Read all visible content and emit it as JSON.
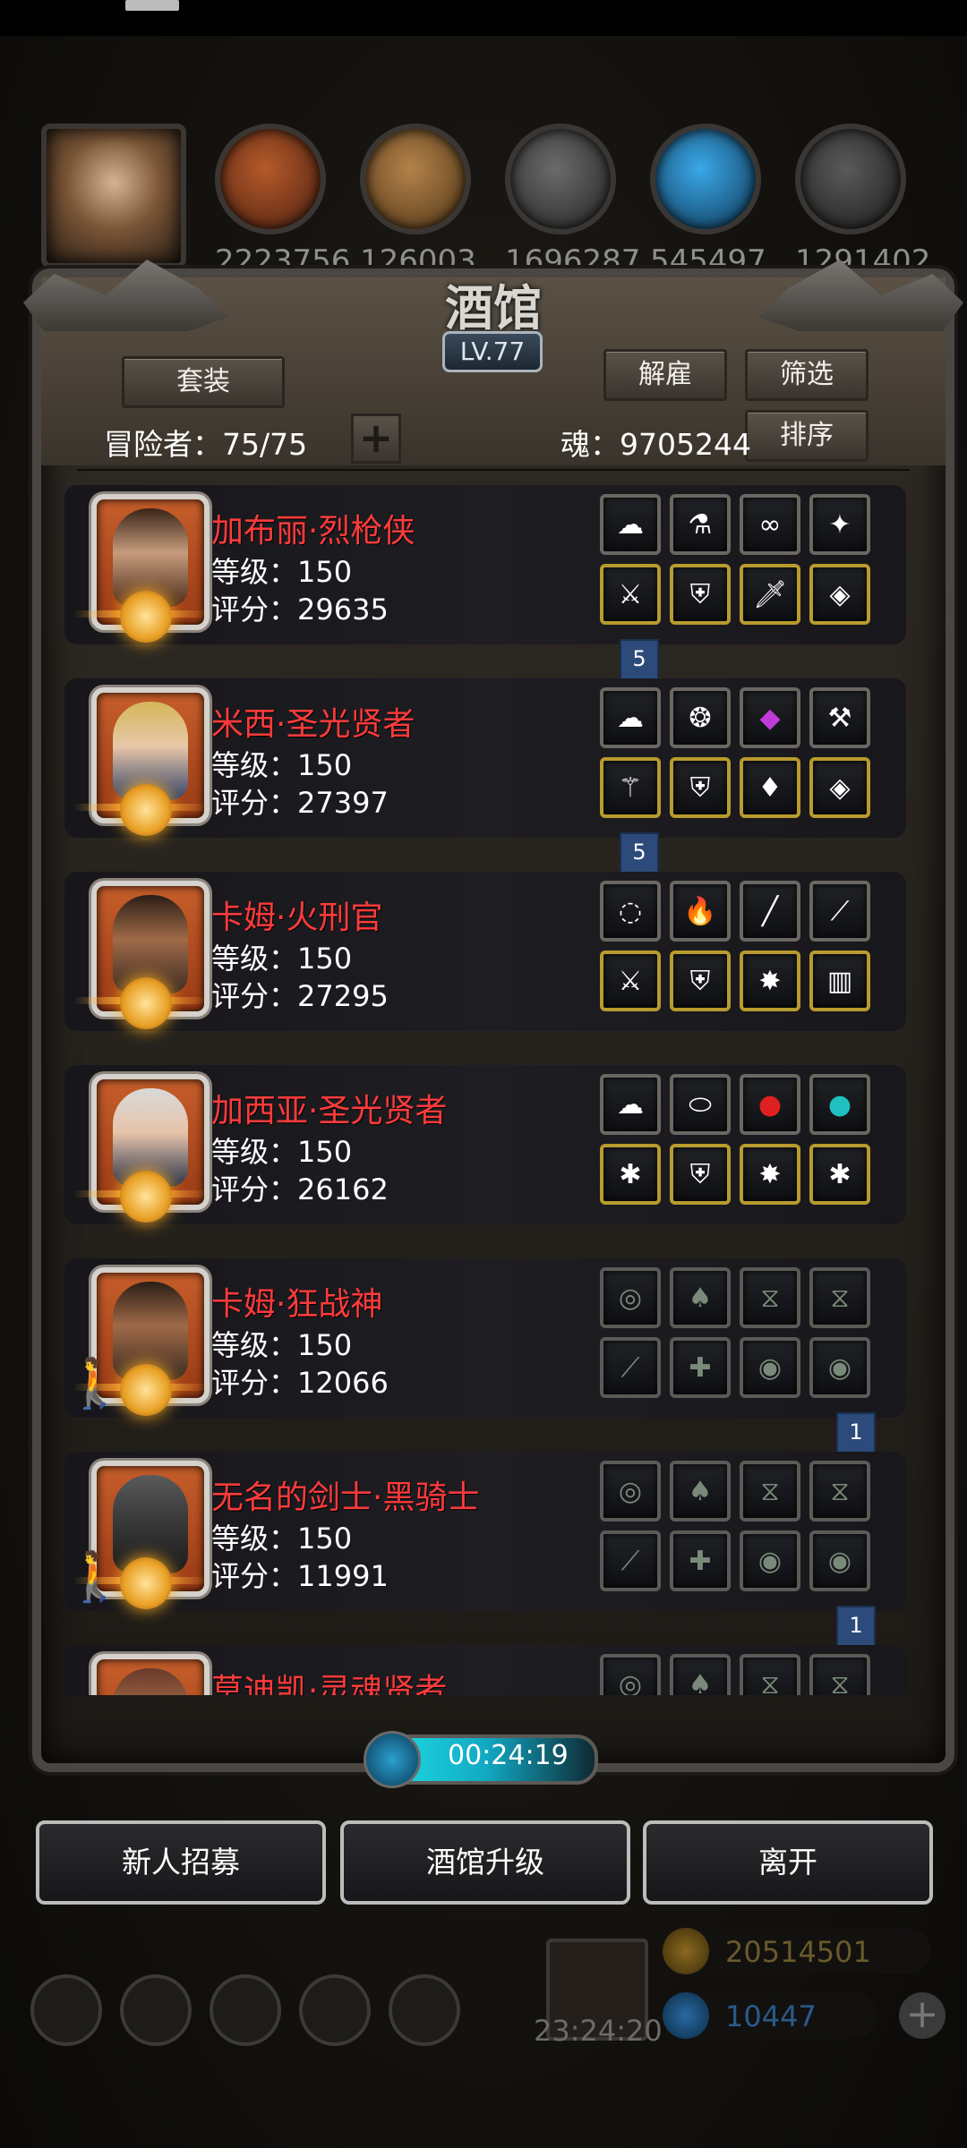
{
  "window": {
    "title": "酒馆",
    "level": "LV.77"
  },
  "resources": [
    "2223756",
    "126003",
    "1696287",
    "545497",
    "1291402"
  ],
  "toolbar": {
    "set_label": "套装",
    "dismiss_label": "解雇",
    "filter_label": "筛选",
    "sort_label": "排序",
    "adventurer_count": "冒险者：75/75",
    "add_symbol": "+",
    "soul": "魂：9705244"
  },
  "heroes": [
    {
      "name": "加布丽·烈枪侠",
      "level": "等级：150",
      "score": "评分：29635",
      "badge": "5"
    },
    {
      "name": "米西·圣光贤者",
      "level": "等级：150",
      "score": "评分：27397",
      "badge": "5"
    },
    {
      "name": "卡姆·火刑官",
      "level": "等级：150",
      "score": "评分：27295",
      "badge": ""
    },
    {
      "name": "加西亚·圣光贤者",
      "level": "等级：150",
      "score": "评分：26162",
      "badge": ""
    },
    {
      "name": "卡姆·狂战神",
      "level": "等级：150",
      "score": "评分：12066",
      "badge": "1"
    },
    {
      "name": "无名的剑士·黑骑士",
      "level": "等级：150",
      "score": "评分：11991",
      "badge": "1"
    },
    {
      "name": "莫迪凯·灵魂贤者",
      "level": "",
      "score": "",
      "badge": ""
    }
  ],
  "timer": "00:24:19",
  "actions": {
    "recruit": "新人招募",
    "upgrade": "酒馆升级",
    "leave": "离开"
  },
  "hud": {
    "gift_time": "23:24:20",
    "gold": "20514501",
    "gems": "10447"
  },
  "colors": {
    "name_red": "#ff3b3b",
    "gold_border": "#b89b2e",
    "timer_cyan": "#1fe0e8"
  }
}
